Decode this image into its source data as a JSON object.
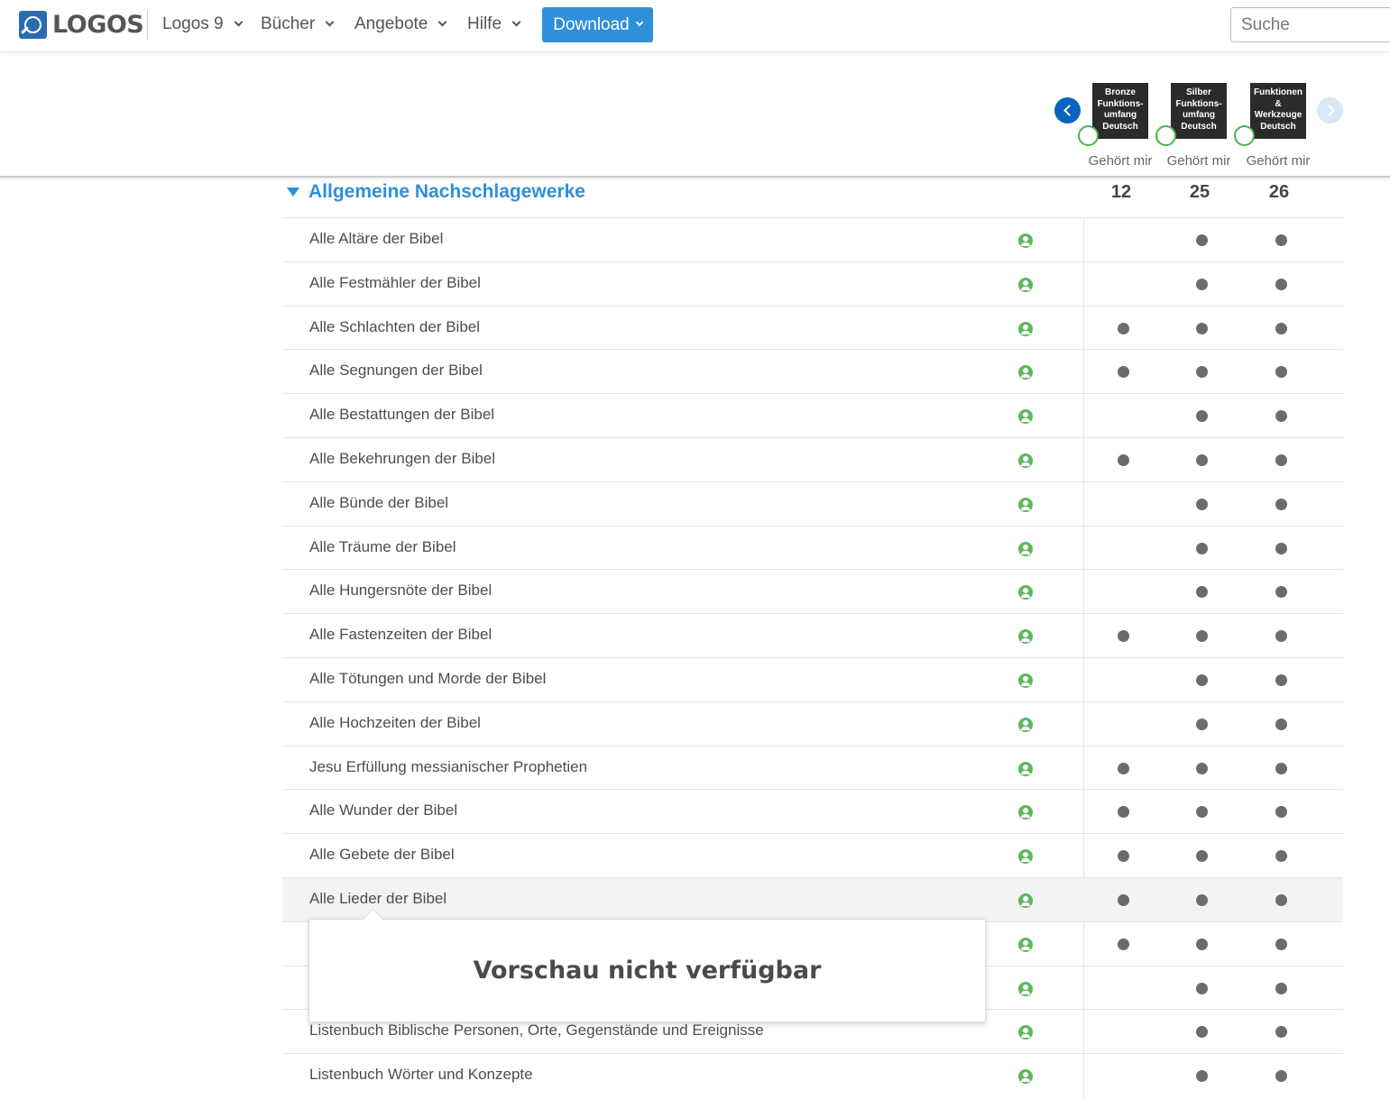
{
  "nav": {
    "logo_text": "LOGOS",
    "items": [
      "Logos 9",
      "Bücher",
      "Angebote",
      "Hilfe"
    ],
    "download_label": "Download",
    "search_placeholder": "Suche"
  },
  "products": [
    {
      "name": "Bronze Funktions- umfang Deutsch",
      "lines": [
        "Bronze",
        "Funktions-",
        "umfang",
        "Deutsch"
      ],
      "owned_label": "Gehört mir",
      "count": "12"
    },
    {
      "name": "Silber Funktions- umfang Deutsch",
      "lines": [
        "Silber",
        "Funktions-",
        "umfang",
        "Deutsch"
      ],
      "owned_label": "Gehört mir",
      "count": "25"
    },
    {
      "name": "Funktionen & Werkzeuge Deutsch",
      "lines": [
        "Funktionen",
        "&",
        "Werkzeuge",
        "Deutsch"
      ],
      "owned_label": "Gehört mir",
      "count": "26"
    }
  ],
  "section": {
    "title": "Allgemeine Nachschlagewerke"
  },
  "rows": [
    {
      "label": "Alle Altäre der Bibel",
      "in": [
        false,
        true,
        true
      ]
    },
    {
      "label": "Alle Festmähler der Bibel",
      "in": [
        false,
        true,
        true
      ]
    },
    {
      "label": "Alle Schlachten der Bibel",
      "in": [
        true,
        true,
        true
      ]
    },
    {
      "label": "Alle Segnungen der Bibel",
      "in": [
        true,
        true,
        true
      ]
    },
    {
      "label": "Alle Bestattungen der Bibel",
      "in": [
        false,
        true,
        true
      ]
    },
    {
      "label": "Alle Bekehrungen der Bibel",
      "in": [
        true,
        true,
        true
      ]
    },
    {
      "label": "Alle Bünde der Bibel",
      "in": [
        false,
        true,
        true
      ]
    },
    {
      "label": "Alle Träume der Bibel",
      "in": [
        false,
        true,
        true
      ]
    },
    {
      "label": "Alle Hungersnöte der Bibel",
      "in": [
        false,
        true,
        true
      ]
    },
    {
      "label": "Alle Fastenzeiten der Bibel",
      "in": [
        true,
        true,
        true
      ]
    },
    {
      "label": "Alle Tötungen und Morde der Bibel",
      "in": [
        false,
        true,
        true
      ]
    },
    {
      "label": "Alle Hochzeiten der Bibel",
      "in": [
        false,
        true,
        true
      ]
    },
    {
      "label": "Jesu Erfüllung messianischer Prophetien",
      "in": [
        true,
        true,
        true
      ]
    },
    {
      "label": "Alle Wunder der Bibel",
      "in": [
        true,
        true,
        true
      ]
    },
    {
      "label": "Alle Gebete der Bibel",
      "in": [
        true,
        true,
        true
      ]
    },
    {
      "label": "Alle Lieder der Bibel",
      "in": [
        true,
        true,
        true
      ],
      "highlight": true
    },
    {
      "label": "",
      "in": [
        true,
        true,
        true
      ]
    },
    {
      "label": "",
      "in": [
        false,
        true,
        true
      ]
    },
    {
      "label": "Listenbuch Biblische Personen, Orte, Gegenstände und Ereignisse",
      "in": [
        false,
        true,
        true
      ]
    },
    {
      "label": "Listenbuch Wörter und Konzepte",
      "in": [
        false,
        true,
        true
      ]
    }
  ],
  "tooltip": {
    "text": "Vorschau nicht verfügbar"
  }
}
